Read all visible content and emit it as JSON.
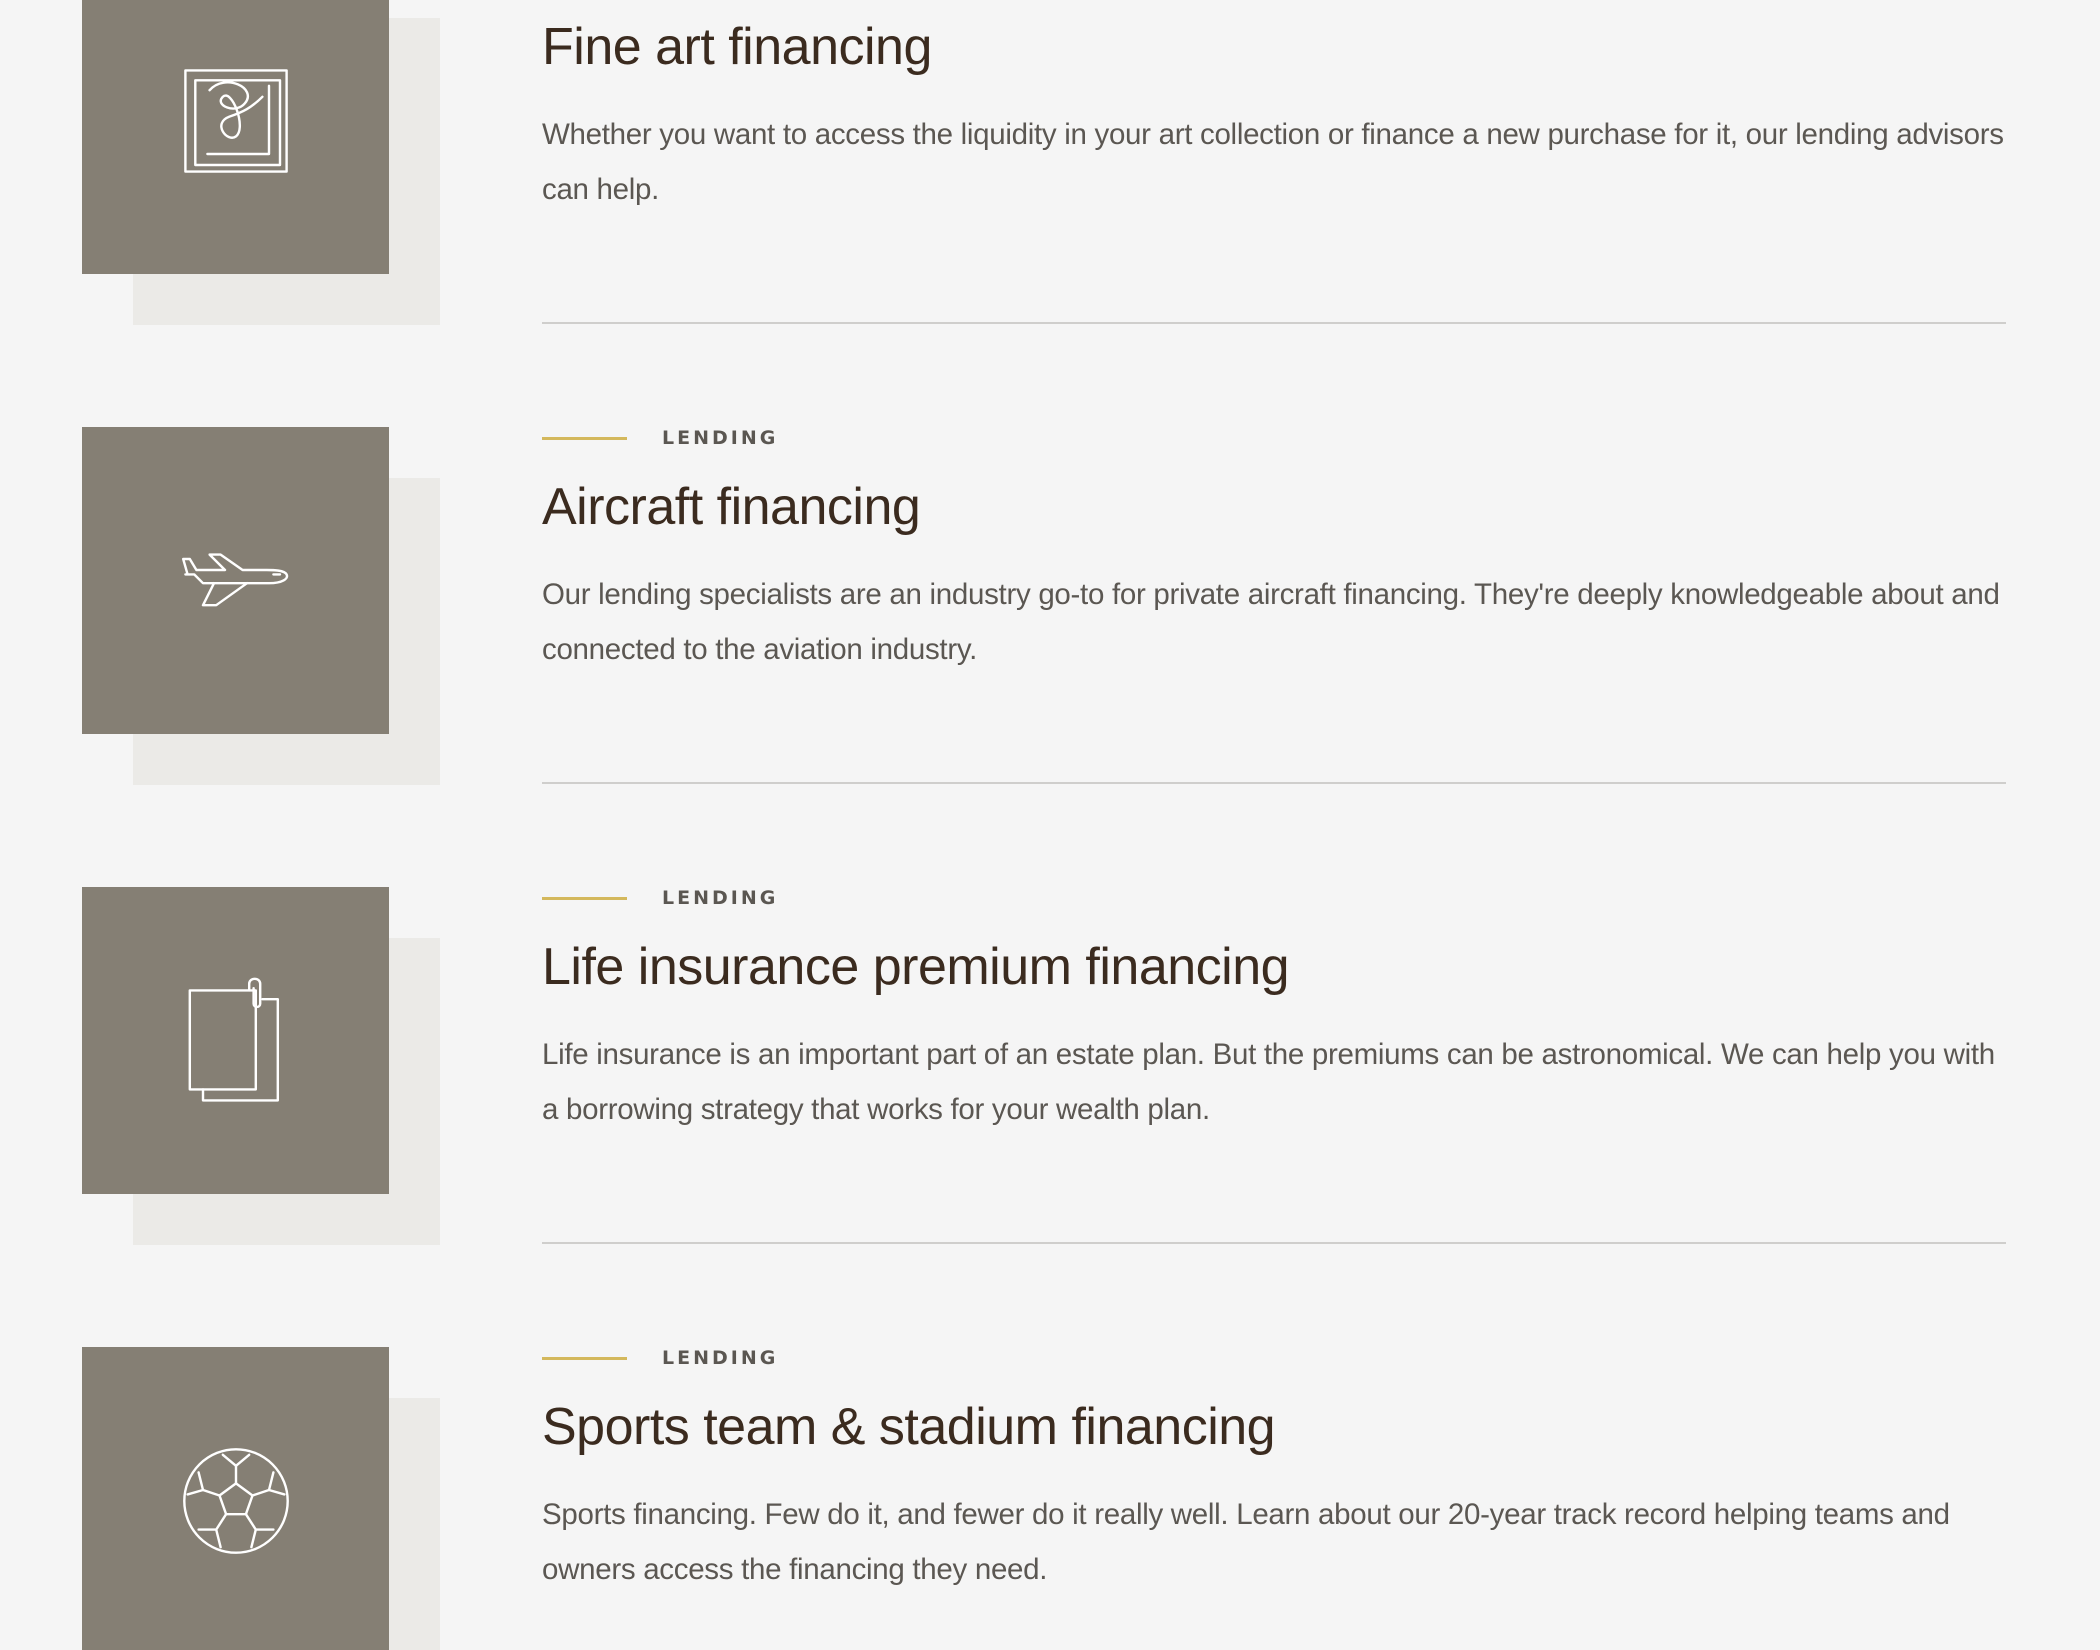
{
  "colors": {
    "background": "#f5f5f5",
    "tile": "#857f74",
    "tile_shadow": "#ebeae7",
    "accent_line": "#d4b85c",
    "title": "#3b2b1f",
    "body_text": "#5b5752",
    "divider": "#cfcecc"
  },
  "cards": [
    {
      "icon": "framed-art-icon",
      "eyebrow": "",
      "title": "Fine art financing",
      "description": "Whether you want to access the liquidity in your art collection or finance a new purchase for it, our lending advisors can help."
    },
    {
      "icon": "airplane-icon",
      "eyebrow": "LENDING",
      "title": "Aircraft financing",
      "description": "Our lending specialists are an industry go-to for private aircraft financing. They're deeply knowledgeable about and connected to the aviation industry."
    },
    {
      "icon": "documents-icon",
      "eyebrow": "LENDING",
      "title": "Life insurance premium financing",
      "description": "Life insurance is an important part of an estate plan. But the premiums can be astronomical. We can help you with a borrowing strategy that works for your wealth plan."
    },
    {
      "icon": "soccer-ball-icon",
      "eyebrow": "LENDING",
      "title": "Sports team & stadium financing",
      "description": "Sports financing. Few do it, and fewer do it really well. Learn about our 20-year track record helping teams and owners access the financing they need."
    }
  ]
}
